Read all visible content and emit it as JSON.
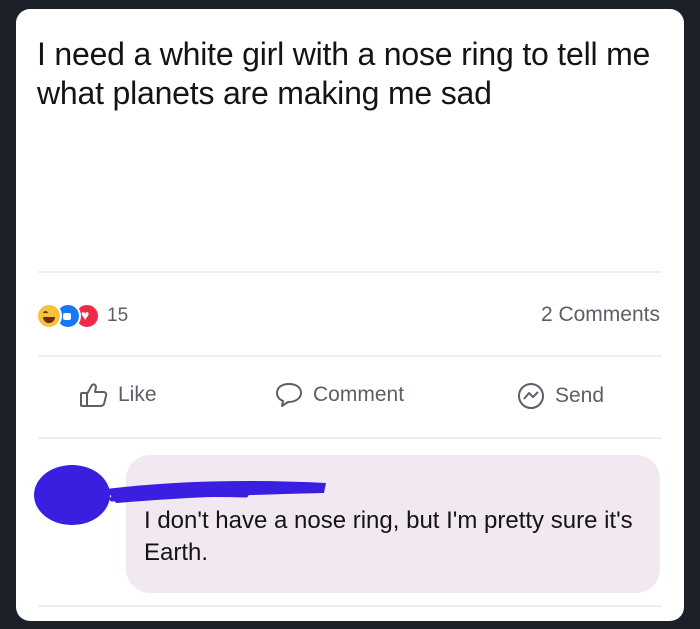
{
  "post": {
    "text": "I need a white girl with a nose ring to tell me what planets are making me sad"
  },
  "reactions": {
    "count": "15",
    "types": [
      "haha-icon",
      "like-icon",
      "love-icon"
    ]
  },
  "comments_count": "2 Comments",
  "actions": {
    "like": "Like",
    "comment": "Comment",
    "send": "Send"
  },
  "comment": {
    "text": "I don't have a nose ring, but I'm pretty sure it's Earth."
  },
  "colors": {
    "redaction": "#3a1fe0",
    "bubble": "#f1e8f1",
    "muted_text": "#5b5f66"
  }
}
